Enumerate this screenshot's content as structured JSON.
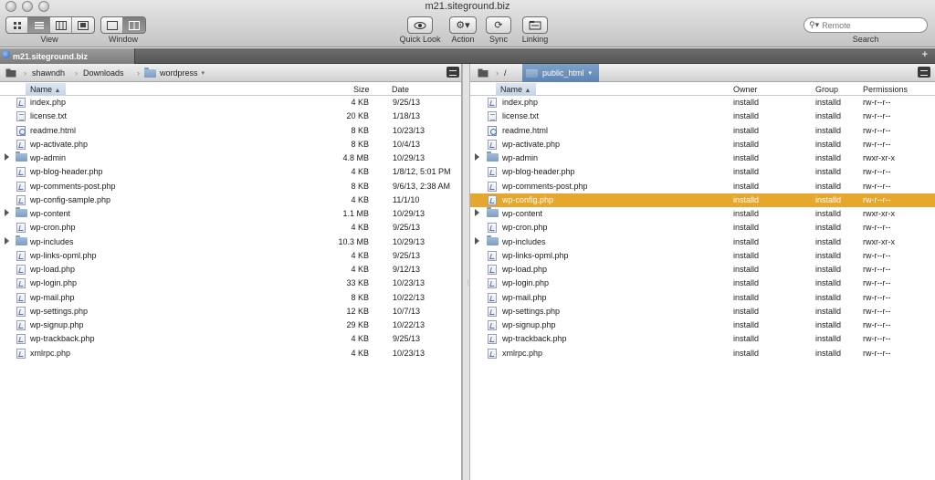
{
  "window": {
    "title": "m21.siteground.biz"
  },
  "toolbar": {
    "view_label": "View",
    "window_label": "Window",
    "quicklook_label": "Quick Look",
    "action_label": "Action",
    "sync_label": "Sync",
    "linking_label": "Linking",
    "search_placeholder": "Remote",
    "search_label": "Search"
  },
  "tab": {
    "label": "m21.siteground.biz"
  },
  "left": {
    "path": [
      "shawndh",
      "Downloads",
      "wordpress"
    ],
    "columns": {
      "name": "Name",
      "size": "Size",
      "date": "Date"
    },
    "rows": [
      {
        "name": "index.php",
        "size": "4 KB",
        "date": "9/25/13",
        "type": "php"
      },
      {
        "name": "license.txt",
        "size": "20 KB",
        "date": "1/18/13",
        "type": "txt"
      },
      {
        "name": "readme.html",
        "size": "8 KB",
        "date": "10/23/13",
        "type": "html"
      },
      {
        "name": "wp-activate.php",
        "size": "8 KB",
        "date": "10/4/13",
        "type": "php"
      },
      {
        "name": "wp-admin",
        "size": "4.8 MB",
        "date": "10/29/13",
        "type": "folder"
      },
      {
        "name": "wp-blog-header.php",
        "size": "4 KB",
        "date": "1/8/12, 5:01 PM",
        "type": "php"
      },
      {
        "name": "wp-comments-post.php",
        "size": "8 KB",
        "date": "9/6/13, 2:38 AM",
        "type": "php"
      },
      {
        "name": "wp-config-sample.php",
        "size": "4 KB",
        "date": "11/1/10",
        "type": "php"
      },
      {
        "name": "wp-content",
        "size": "1.1 MB",
        "date": "10/29/13",
        "type": "folder"
      },
      {
        "name": "wp-cron.php",
        "size": "4 KB",
        "date": "9/25/13",
        "type": "php"
      },
      {
        "name": "wp-includes",
        "size": "10.3 MB",
        "date": "10/29/13",
        "type": "folder"
      },
      {
        "name": "wp-links-opml.php",
        "size": "4 KB",
        "date": "9/25/13",
        "type": "php"
      },
      {
        "name": "wp-load.php",
        "size": "4 KB",
        "date": "9/12/13",
        "type": "php"
      },
      {
        "name": "wp-login.php",
        "size": "33 KB",
        "date": "10/23/13",
        "type": "php"
      },
      {
        "name": "wp-mail.php",
        "size": "8 KB",
        "date": "10/22/13",
        "type": "php"
      },
      {
        "name": "wp-settings.php",
        "size": "12 KB",
        "date": "10/7/13",
        "type": "php"
      },
      {
        "name": "wp-signup.php",
        "size": "29 KB",
        "date": "10/22/13",
        "type": "php"
      },
      {
        "name": "wp-trackback.php",
        "size": "4 KB",
        "date": "9/25/13",
        "type": "php"
      },
      {
        "name": "xmlrpc.php",
        "size": "4 KB",
        "date": "10/23/13",
        "type": "php"
      }
    ]
  },
  "right": {
    "path": [
      "/",
      "public_html"
    ],
    "columns": {
      "name": "Name",
      "owner": "Owner",
      "group": "Group",
      "permissions": "Permissions"
    },
    "selected_index": 7,
    "rows": [
      {
        "name": "index.php",
        "owner": "installd",
        "group": "installd",
        "perm": "rw-r--r--",
        "type": "php"
      },
      {
        "name": "license.txt",
        "owner": "installd",
        "group": "installd",
        "perm": "rw-r--r--",
        "type": "txt"
      },
      {
        "name": "readme.html",
        "owner": "installd",
        "group": "installd",
        "perm": "rw-r--r--",
        "type": "html"
      },
      {
        "name": "wp-activate.php",
        "owner": "installd",
        "group": "installd",
        "perm": "rw-r--r--",
        "type": "php"
      },
      {
        "name": "wp-admin",
        "owner": "installd",
        "group": "installd",
        "perm": "rwxr-xr-x",
        "type": "folder"
      },
      {
        "name": "wp-blog-header.php",
        "owner": "installd",
        "group": "installd",
        "perm": "rw-r--r--",
        "type": "php"
      },
      {
        "name": "wp-comments-post.php",
        "owner": "installd",
        "group": "installd",
        "perm": "rw-r--r--",
        "type": "php"
      },
      {
        "name": "wp-config.php",
        "owner": "installd",
        "group": "installd",
        "perm": "rw-r--r--",
        "type": "php"
      },
      {
        "name": "wp-content",
        "owner": "installd",
        "group": "installd",
        "perm": "rwxr-xr-x",
        "type": "folder"
      },
      {
        "name": "wp-cron.php",
        "owner": "installd",
        "group": "installd",
        "perm": "rw-r--r--",
        "type": "php"
      },
      {
        "name": "wp-includes",
        "owner": "installd",
        "group": "installd",
        "perm": "rwxr-xr-x",
        "type": "folder"
      },
      {
        "name": "wp-links-opml.php",
        "owner": "installd",
        "group": "installd",
        "perm": "rw-r--r--",
        "type": "php"
      },
      {
        "name": "wp-load.php",
        "owner": "installd",
        "group": "installd",
        "perm": "rw-r--r--",
        "type": "php"
      },
      {
        "name": "wp-login.php",
        "owner": "installd",
        "group": "installd",
        "perm": "rw-r--r--",
        "type": "php"
      },
      {
        "name": "wp-mail.php",
        "owner": "installd",
        "group": "installd",
        "perm": "rw-r--r--",
        "type": "php"
      },
      {
        "name": "wp-settings.php",
        "owner": "installd",
        "group": "installd",
        "perm": "rw-r--r--",
        "type": "php"
      },
      {
        "name": "wp-signup.php",
        "owner": "installd",
        "group": "installd",
        "perm": "rw-r--r--",
        "type": "php"
      },
      {
        "name": "wp-trackback.php",
        "owner": "installd",
        "group": "installd",
        "perm": "rw-r--r--",
        "type": "php"
      },
      {
        "name": "xmlrpc.php",
        "owner": "installd",
        "group": "installd",
        "perm": "rw-r--r--",
        "type": "php"
      }
    ]
  },
  "colors": {
    "selection": "#e5a72e",
    "path_active": "#6a8fbd"
  }
}
